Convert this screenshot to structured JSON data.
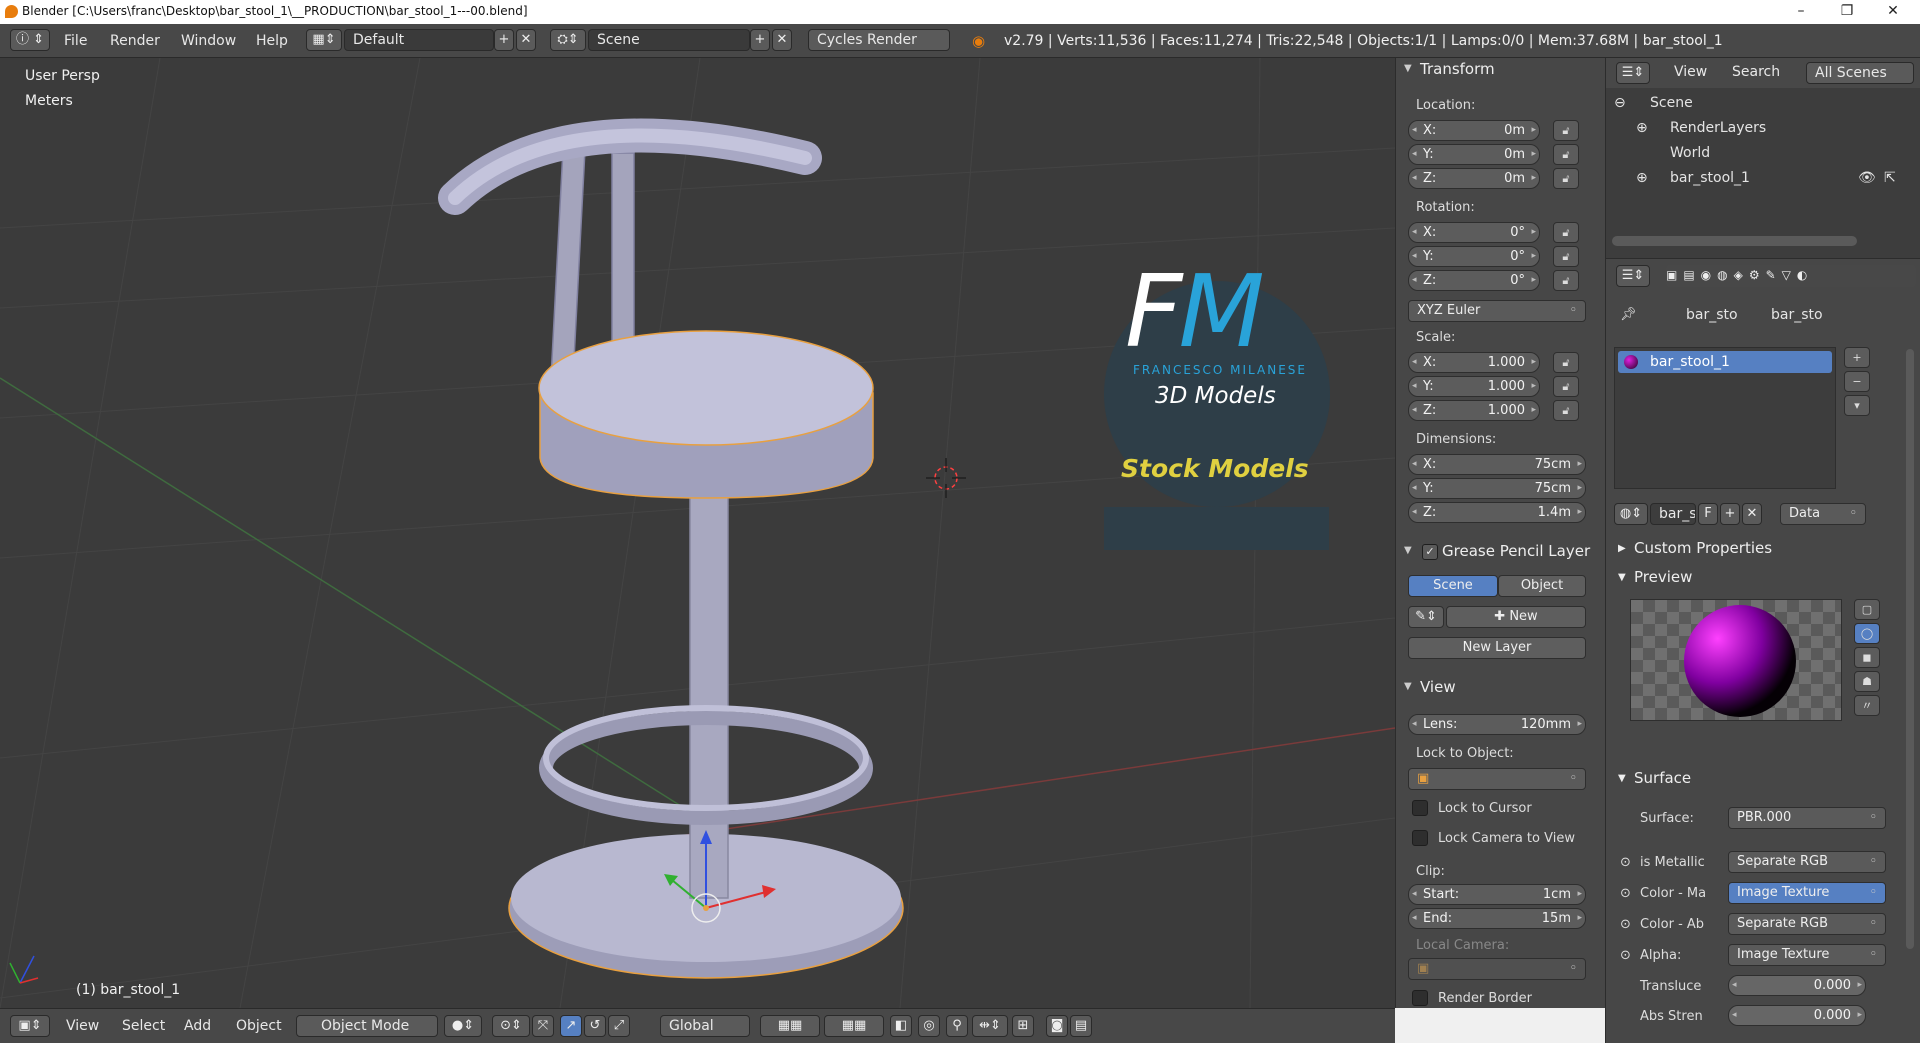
{
  "titlebar": {
    "title": "Blender [C:\\Users\\franc\\Desktop\\bar_stool_1\\__PRODUCTION\\bar_stool_1---00.blend]",
    "minimize": "–",
    "maximize": "❐",
    "close": "✕"
  },
  "info": {
    "menus": [
      "File",
      "Render",
      "Window",
      "Help"
    ],
    "layout": "Default",
    "scene": "Scene",
    "engine": "Cycles Render",
    "stats": "v2.79 | Verts:11,536 | Faces:11,274 | Tris:22,548 | Objects:1/1 | Lamps:0/0 | Mem:37.68M | bar_stool_1"
  },
  "viewport": {
    "view_name": "User Persp",
    "units": "Meters",
    "selected": "(1) bar_stool_1",
    "logo_letters": "FM",
    "logo_name": "FRANCESCO MILANESE",
    "logo_sub": "3D Models",
    "stock": "Stock Models"
  },
  "bottom": {
    "menus": [
      "View",
      "Select",
      "Add",
      "Object"
    ],
    "mode": "Object Mode",
    "orientation": "Global"
  },
  "transform": {
    "header": "Transform",
    "location_label": "Location:",
    "location": [
      {
        "k": "X:",
        "v": "0m"
      },
      {
        "k": "Y:",
        "v": "0m"
      },
      {
        "k": "Z:",
        "v": "0m"
      }
    ],
    "rotation_label": "Rotation:",
    "rotation": [
      {
        "k": "X:",
        "v": "0°"
      },
      {
        "k": "Y:",
        "v": "0°"
      },
      {
        "k": "Z:",
        "v": "0°"
      }
    ],
    "rotation_mode": "XYZ Euler",
    "scale_label": "Scale:",
    "scale": [
      {
        "k": "X:",
        "v": "1.000"
      },
      {
        "k": "Y:",
        "v": "1.000"
      },
      {
        "k": "Z:",
        "v": "1.000"
      }
    ],
    "dimensions_label": "Dimensions:",
    "dimensions": [
      {
        "k": "X:",
        "v": "75cm"
      },
      {
        "k": "Y:",
        "v": "75cm"
      },
      {
        "k": "Z:",
        "v": "1.4m"
      }
    ]
  },
  "grease": {
    "header": "Grease Pencil Layer",
    "scene_tab": "Scene",
    "object_tab": "Object",
    "new": "New",
    "new_layer": "New Layer"
  },
  "view": {
    "header": "View",
    "lens_label": "Lens:",
    "lens": "120mm",
    "lock_obj_label": "Lock to Object:",
    "lock_cursor": "Lock to Cursor",
    "lock_camera": "Lock Camera to View",
    "clip_label": "Clip:",
    "clip_start_k": "Start:",
    "clip_start": "1cm",
    "clip_end_k": "End:",
    "clip_end": "15m",
    "local_camera": "Local Camera:",
    "render_border": "Render Border"
  },
  "outliner": {
    "view": "View",
    "search": "Search",
    "filter": "All Scenes",
    "items": [
      "Scene",
      "RenderLayers",
      "World",
      "bar_stool_1"
    ]
  },
  "props": {
    "crumb1": "bar_sto",
    "crumb2": "bar_sto",
    "material": "bar_stool_1",
    "mat_field": "bar_s",
    "fake": "F",
    "link": "Data",
    "custom_props": "Custom Properties",
    "preview": "Preview",
    "surface_header": "Surface",
    "surface_label": "Surface:",
    "surface_val": "PBR.000",
    "rows": [
      {
        "k": "is Metallic",
        "v": "Separate RGB",
        "blue": false
      },
      {
        "k": "Color - Ma",
        "v": "Image Texture",
        "blue": true
      },
      {
        "k": "Color - Ab",
        "v": "Separate RGB",
        "blue": false
      },
      {
        "k": "Alpha:",
        "v": "Image Texture",
        "blue": false
      }
    ],
    "transluce_k": "Transluce",
    "transluce_v": "0.000",
    "abs_k": "Abs Stren",
    "abs_v": "0.000"
  },
  "colors": {
    "viewport_bg": "#3b3b3b",
    "panel_bg": "#474747",
    "selection": "#5680c2",
    "outline": "#e8a040",
    "logo": "#29a3d9",
    "stock": "#e0d040"
  }
}
